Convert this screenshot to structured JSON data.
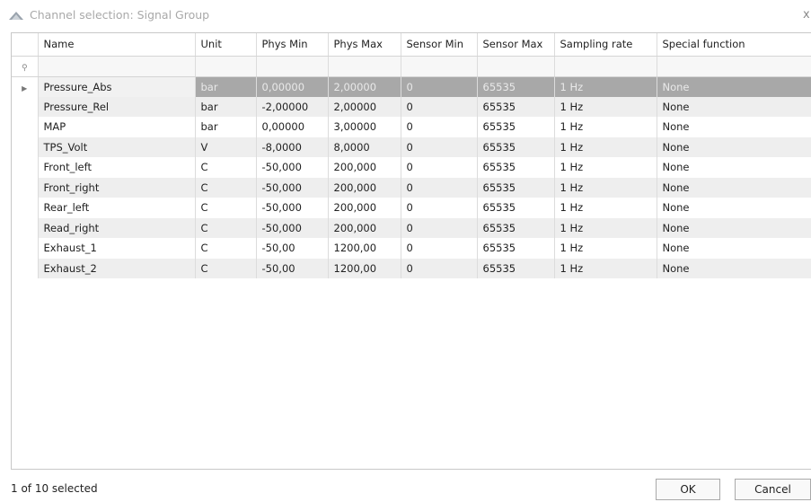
{
  "window": {
    "title": "Channel selection: Signal Group",
    "close_glyph": "x"
  },
  "table": {
    "columns": [
      "Name",
      "Unit",
      "Phys Min",
      "Phys Max",
      "Sensor Min",
      "Sensor Max",
      "Sampling rate",
      "Special function"
    ],
    "rows": [
      [
        "Pressure_Abs",
        "bar",
        "0,00000",
        "2,00000",
        "0",
        "65535",
        "1 Hz",
        "None"
      ],
      [
        "Pressure_Rel",
        "bar",
        "-2,00000",
        "2,00000",
        "0",
        "65535",
        "1 Hz",
        "None"
      ],
      [
        "MAP",
        "bar",
        "0,00000",
        "3,00000",
        "0",
        "65535",
        "1 Hz",
        "None"
      ],
      [
        "TPS_Volt",
        "V",
        "-8,0000",
        "8,0000",
        "0",
        "65535",
        "1 Hz",
        "None"
      ],
      [
        "Front_left",
        "C",
        "-50,000",
        "200,000",
        "0",
        "65535",
        "1 Hz",
        "None"
      ],
      [
        "Front_right",
        "C",
        "-50,000",
        "200,000",
        "0",
        "65535",
        "1 Hz",
        "None"
      ],
      [
        "Rear_left",
        "C",
        "-50,000",
        "200,000",
        "0",
        "65535",
        "1 Hz",
        "None"
      ],
      [
        "Read_right",
        "C",
        "-50,000",
        "200,000",
        "0",
        "65535",
        "1 Hz",
        "None"
      ],
      [
        "Exhaust_1",
        "C",
        "-50,00",
        "1200,00",
        "0",
        "65535",
        "1 Hz",
        "None"
      ],
      [
        "Exhaust_2",
        "C",
        "-50,00",
        "1200,00",
        "0",
        "65535",
        "1 Hz",
        "None"
      ]
    ],
    "selected_row": 0
  },
  "footer": {
    "status": "1 of 10 selected",
    "ok_label": "OK",
    "cancel_label": "Cancel"
  },
  "icons": {
    "window": "signal-group-icon",
    "filter": "pin-icon",
    "row_indicator": "row-pointer-icon"
  },
  "colors": {
    "selected_row_bg": "#a8a8a8",
    "alt_row_bg": "#eeeeee",
    "title_text": "#a9a9a9"
  }
}
